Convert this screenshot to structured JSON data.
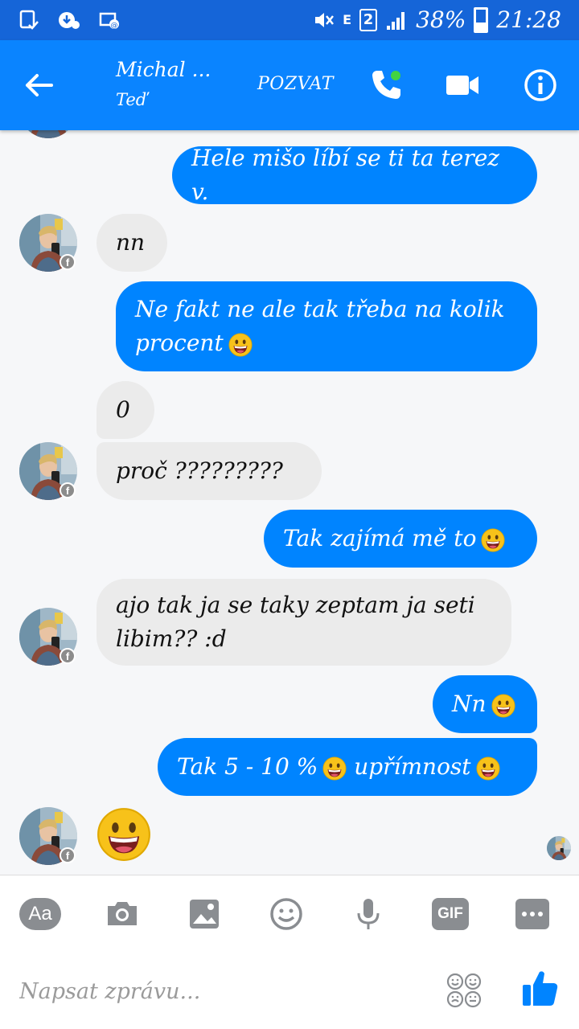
{
  "status_bar": {
    "battery": "38%",
    "time": "21:28",
    "sim": "2",
    "network": "E"
  },
  "header": {
    "title": "Michal ...",
    "subtitle": "Teď",
    "invite_label": "POZVAT",
    "accent": "#0084ff"
  },
  "messages": [
    {
      "side": "out",
      "text": "Hele mišo líbí se ti ta terez v."
    },
    {
      "side": "in",
      "text": "nn"
    },
    {
      "side": "out",
      "text": "Ne fakt ne ale tak třeba na kolik procent",
      "emoji": "grinning-emoji"
    },
    {
      "side": "in",
      "text": "0"
    },
    {
      "side": "in",
      "text": "proč ?????????"
    },
    {
      "side": "out",
      "text": "Tak zajímá mě to",
      "emoji": "grinning-emoji"
    },
    {
      "side": "in",
      "text": "ajo tak ja se taky zeptam ja seti libim?? :d"
    },
    {
      "side": "out",
      "text": "Nn",
      "emoji": "grinning-emoji"
    },
    {
      "side": "out",
      "text_a": "Tak 5 - 10 %",
      "text_b": "upřímnost",
      "emoji": "grinning-emoji"
    },
    {
      "side": "in",
      "emoji": "big-grinning-emoji"
    }
  ],
  "composer": {
    "aa_label": "Aa",
    "gif_label": "GIF",
    "placeholder": "Napsat zprávu..."
  },
  "colors": {
    "status_bar": "#1565d8",
    "header": "#0a84ff",
    "outgoing_bubble": "#0084ff",
    "incoming_bubble": "#ebebeb",
    "emoji": "#f7c21a"
  }
}
